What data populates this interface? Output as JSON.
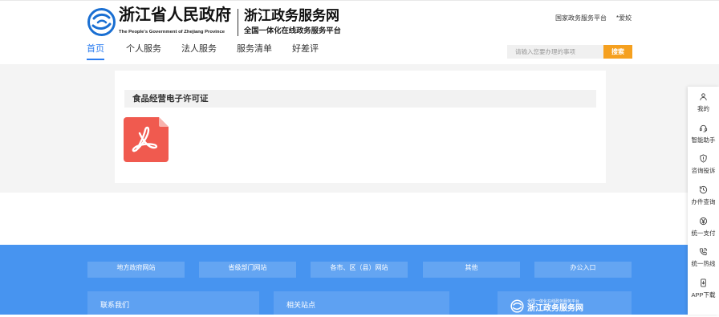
{
  "header": {
    "gov_title": "浙江省人民政府",
    "gov_subtitle": "The People's Government of Zhejiang Province",
    "site_title": "浙江政务服务网",
    "site_subtitle": "全国一体化在线政务服务平台",
    "national_link": "国家政务服务平台",
    "user": "*爱姣"
  },
  "nav": {
    "items": [
      "首页",
      "个人服务",
      "法人服务",
      "服务清单",
      "好差评"
    ],
    "active": "首页"
  },
  "search": {
    "placeholder": "请输入您要办理的事项",
    "button": "搜索"
  },
  "content": {
    "title": "食品经营电子许可证",
    "file_icon": "pdf-icon"
  },
  "footer": {
    "tabs": [
      "地方政府网站",
      "省级部门网站",
      "各市、区（县）网站",
      "其他",
      "办公入口"
    ],
    "contact_label": "联系我们",
    "related_label": "相关站点",
    "logo_subtitle": "全国一体化在线政务服务平台",
    "logo_title": "浙江政务服务网"
  },
  "sidebar": {
    "items": [
      {
        "label": "我的",
        "icon": "user-icon"
      },
      {
        "label": "智能助手",
        "icon": "headset-icon"
      },
      {
        "label": "咨询投诉",
        "icon": "shield-icon"
      },
      {
        "label": "办件查询",
        "icon": "history-icon"
      },
      {
        "label": "统一支付",
        "icon": "yen-icon"
      },
      {
        "label": "统一热线",
        "icon": "phone-icon"
      },
      {
        "label": "APP下载",
        "icon": "app-download-icon"
      }
    ]
  },
  "colors": {
    "primary": "#2a7cf0",
    "accent": "#f5a01f",
    "footer": "#4794f0",
    "pdf": "#f05a4f"
  }
}
